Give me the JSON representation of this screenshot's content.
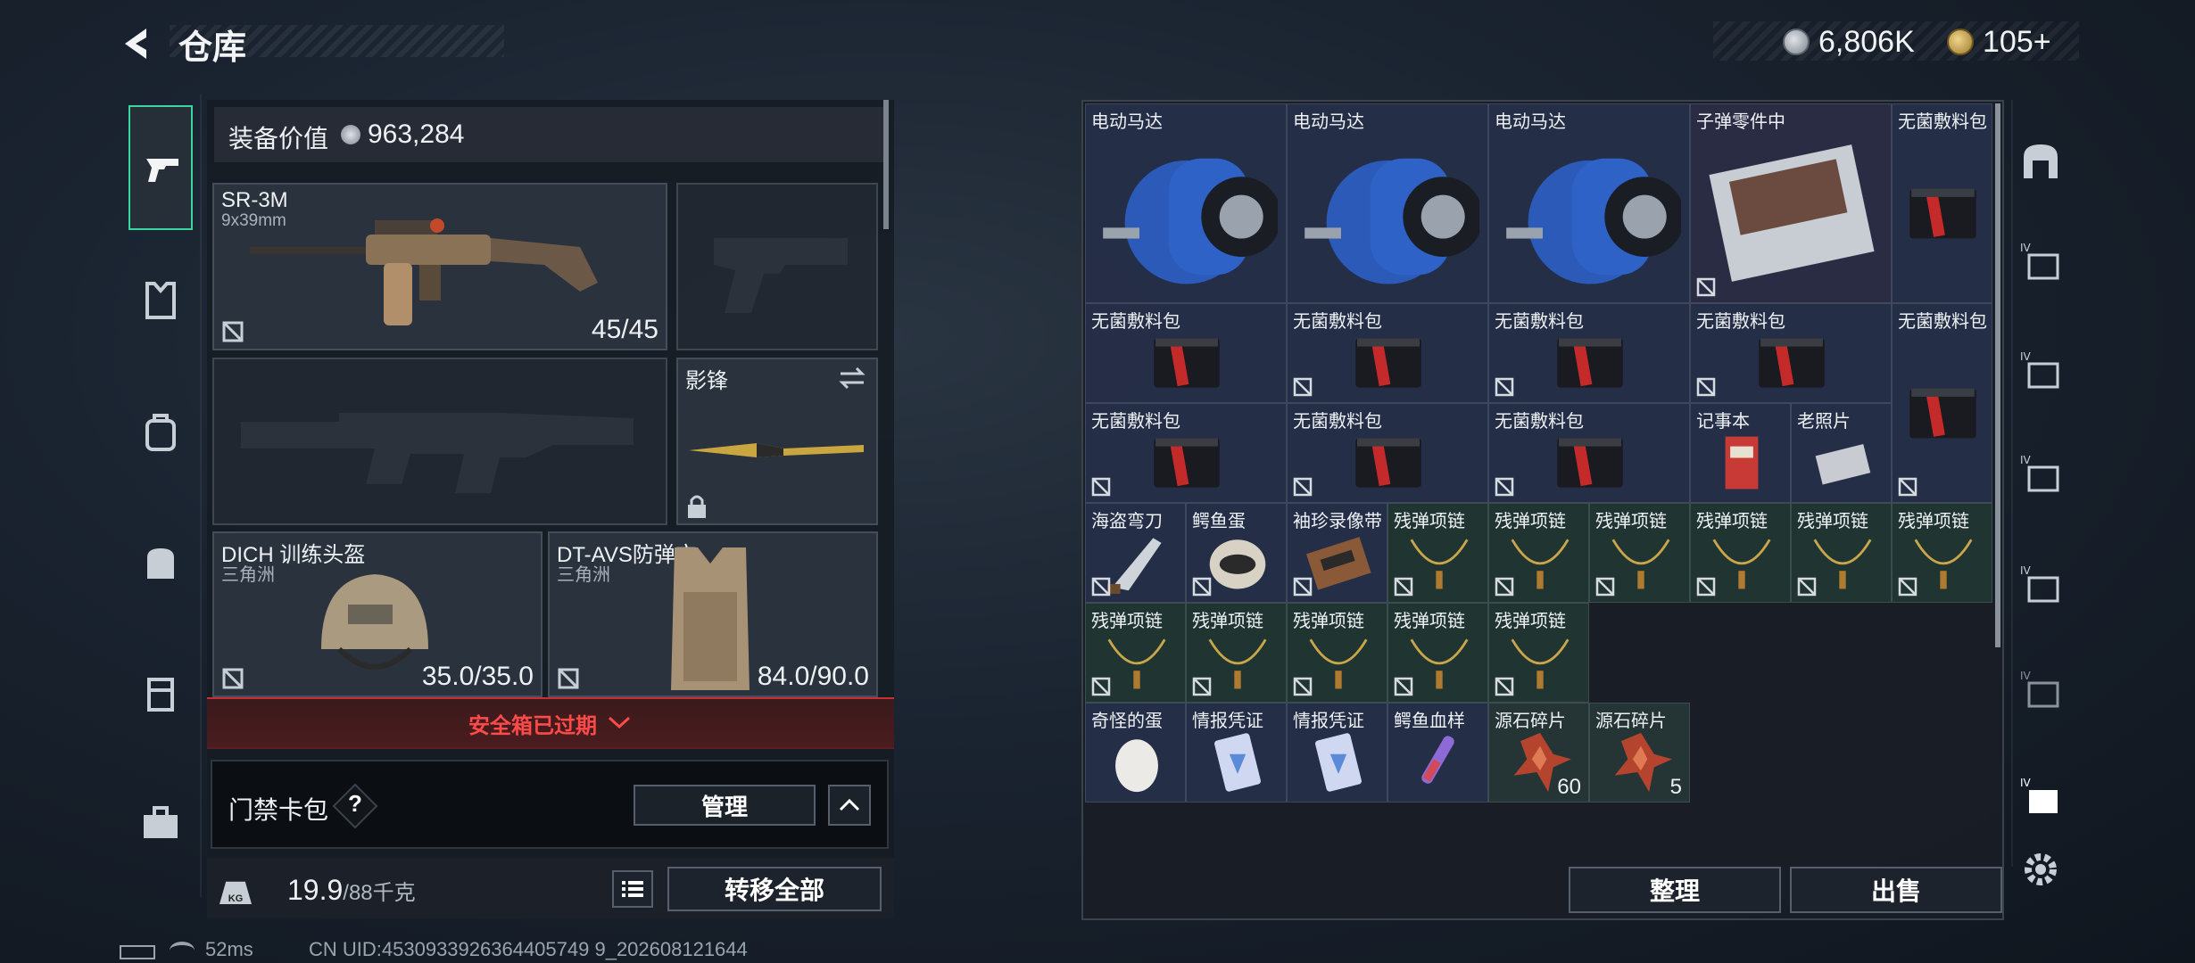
{
  "header": {
    "title": "仓库",
    "currency_amount": "6,806K",
    "coin_amount": "105",
    "coin_plus": "+"
  },
  "left": {
    "equip_value_label": "装备价值",
    "equip_value": "963,284",
    "primary": {
      "name": "SR-3M",
      "caliber": "9x39mm",
      "ammo": "45/45"
    },
    "melee": {
      "name": "影锋"
    },
    "helmet": {
      "name": "DICH 训练头盔",
      "origin": "三角洲",
      "durability": "35.0/35.0"
    },
    "armor": {
      "name": "DT-AVS防弹衣",
      "origin": "三角洲",
      "durability": "84.0/90.0"
    },
    "safebox_text": "安全箱已过期",
    "keycard_label": "门禁卡包",
    "keycard_help": "?",
    "manage_label": "管理",
    "weight_current": "19.9",
    "weight_max": "/88千克",
    "transfer_all_label": "转移全部"
  },
  "stash": {
    "items": [
      {
        "label": "电动马达",
        "icon": "motor"
      },
      {
        "label": "电动马达",
        "icon": "motor"
      },
      {
        "label": "电动马达",
        "icon": "motor"
      },
      {
        "label": "子弹零件中",
        "icon": "ammo-parts"
      },
      {
        "label": "无菌敷料包",
        "icon": "bandage"
      },
      {
        "label": "无菌敷料包",
        "icon": "bandage"
      },
      {
        "label": "无菌敷料包",
        "icon": "bandage"
      },
      {
        "label": "无菌敷料包",
        "icon": "bandage"
      },
      {
        "label": "无菌敷料包",
        "icon": "bandage"
      },
      {
        "label": "无菌敷料包",
        "icon": "bandage"
      },
      {
        "label": "无菌敷料包",
        "icon": "bandage"
      },
      {
        "label": "无菌敷料包",
        "icon": "bandage"
      },
      {
        "label": "无菌敷料包",
        "icon": "bandage"
      },
      {
        "label": "记事本",
        "icon": "notebook"
      },
      {
        "label": "老照片",
        "icon": "photo"
      },
      {
        "label": "海盗弯刀",
        "icon": "machete"
      },
      {
        "label": "鳄鱼蛋",
        "icon": "croc-egg"
      },
      {
        "label": "袖珍录像带",
        "icon": "cassette"
      },
      {
        "label": "残弹项链",
        "icon": "necklace"
      },
      {
        "label": "残弹项链",
        "icon": "necklace"
      },
      {
        "label": "残弹项链",
        "icon": "necklace"
      },
      {
        "label": "残弹项链",
        "icon": "necklace"
      },
      {
        "label": "残弹项链",
        "icon": "necklace"
      },
      {
        "label": "残弹项链",
        "icon": "necklace"
      },
      {
        "label": "残弹项链",
        "icon": "necklace"
      },
      {
        "label": "残弹项链",
        "icon": "necklace"
      },
      {
        "label": "残弹项链",
        "icon": "necklace"
      },
      {
        "label": "残弹项链",
        "icon": "necklace"
      },
      {
        "label": "残弹项链",
        "icon": "necklace"
      },
      {
        "label": "奇怪的蛋",
        "icon": "egg"
      },
      {
        "label": "情报凭证",
        "icon": "intel-card"
      },
      {
        "label": "情报凭证",
        "icon": "intel-card"
      },
      {
        "label": "鳄鱼血样",
        "icon": "blood-vial"
      },
      {
        "label": "源石碎片",
        "icon": "crystal",
        "count": "60"
      },
      {
        "label": "源石碎片",
        "icon": "crystal",
        "count": "5"
      }
    ],
    "sort_label": "整理",
    "sell_label": "出售"
  },
  "status": {
    "ping": "52ms",
    "uid": "CN UID:4530933926364405749 9_202608121644"
  }
}
